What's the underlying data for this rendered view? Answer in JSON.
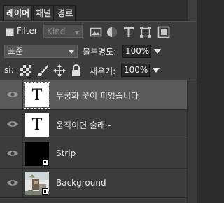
{
  "tabs": [
    "레이어",
    "채널",
    "경로"
  ],
  "filter": {
    "label": "Filter",
    "kind_value": "Kind",
    "icons": [
      "image-filter-icon",
      "circle-filter-icon",
      "type-filter-icon",
      "shape-filter-icon",
      "smart-object-filter-icon"
    ]
  },
  "blend": {
    "mode": "표준",
    "opacity_label": "불투명도:",
    "opacity_value": "100%"
  },
  "lock": {
    "label": "si:",
    "fill_label": "채우기:",
    "fill_value": "100%"
  },
  "layers": [
    {
      "name": "무궁화 꽃이 피었습니다",
      "thumb_text": "T",
      "selected": true
    },
    {
      "name": "움직이면 술래~",
      "thumb_text": "T",
      "selected": false
    },
    {
      "name": "Strip",
      "selected": false
    },
    {
      "name": "Background",
      "selected": false
    }
  ]
}
